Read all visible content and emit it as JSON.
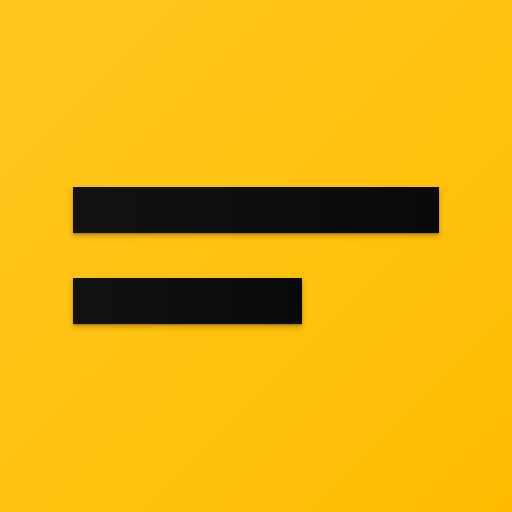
{
  "icon": {
    "name": "short-text-icon",
    "background_color": "#FFC20F",
    "foreground_color": "#0E0E0E"
  }
}
